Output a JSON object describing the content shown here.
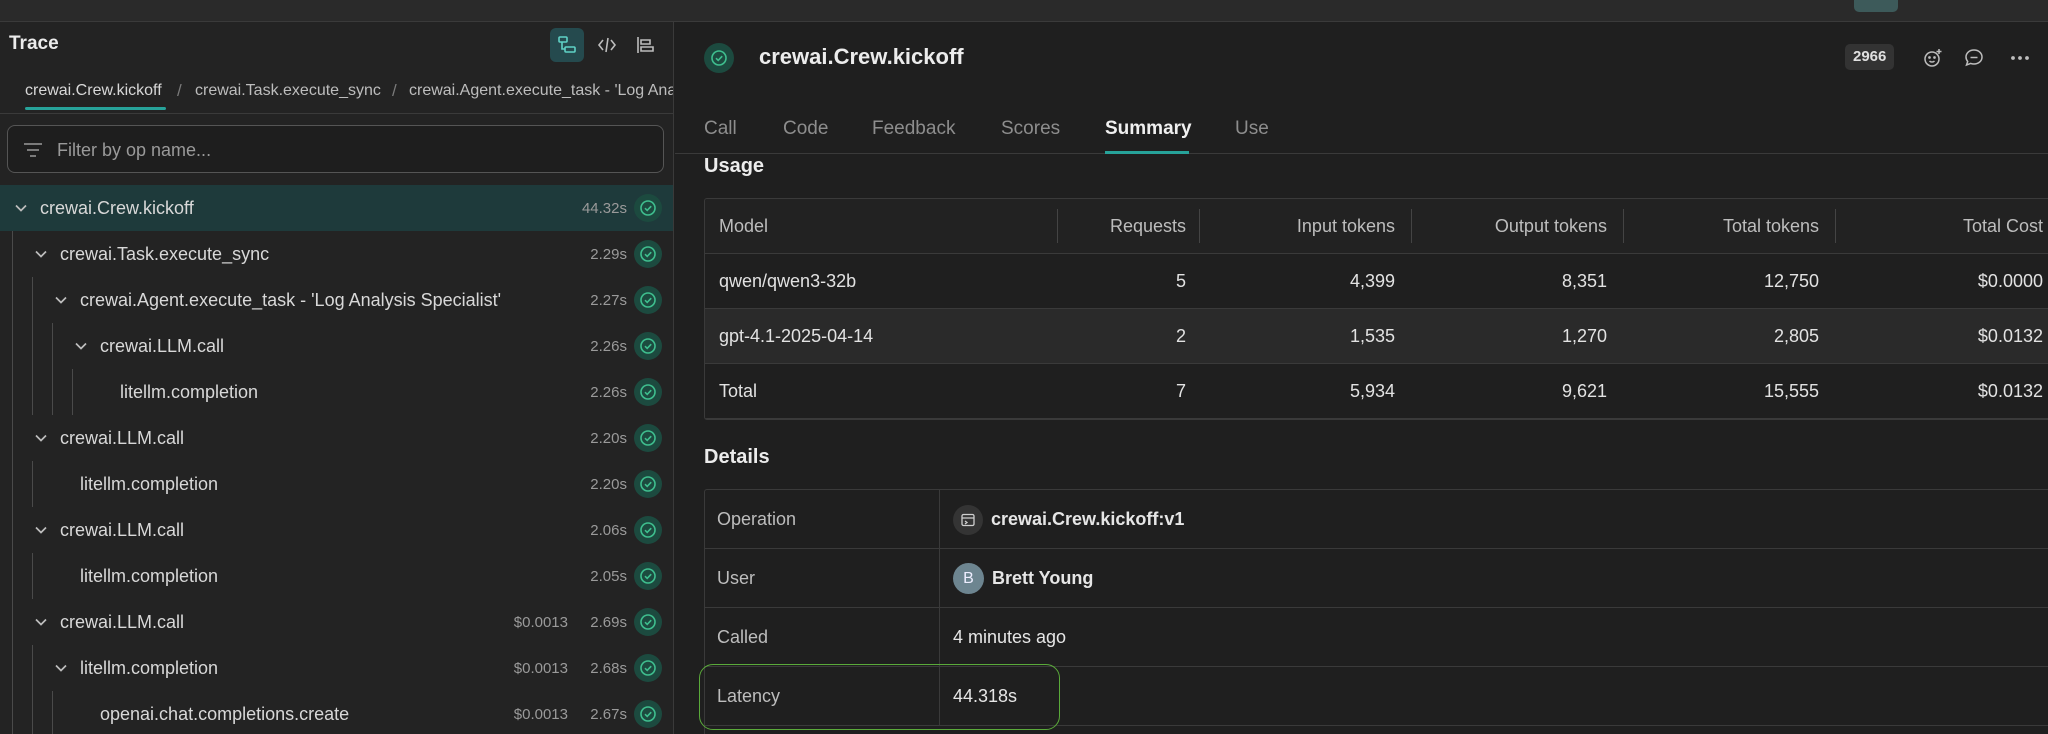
{
  "left": {
    "title": "Trace",
    "view_icons": [
      "tree-view-icon",
      "code-icon",
      "timeline-icon"
    ],
    "breadcrumbs": [
      "crewai.Crew.kickoff",
      "crewai.Task.execute_sync",
      "crewai.Agent.execute_task - 'Log Ana"
    ],
    "filter_placeholder": "Filter by op name...",
    "tree": [
      {
        "label": "crewai.Crew.kickoff",
        "time": "44.32s",
        "cost": ""
      },
      {
        "label": "crewai.Task.execute_sync",
        "time": "2.29s",
        "cost": ""
      },
      {
        "label": "crewai.Agent.execute_task - 'Log Analysis Specialist'",
        "time": "2.27s",
        "cost": ""
      },
      {
        "label": "crewai.LLM.call",
        "time": "2.26s",
        "cost": ""
      },
      {
        "label": "litellm.completion",
        "time": "2.26s",
        "cost": ""
      },
      {
        "label": "crewai.LLM.call",
        "time": "2.20s",
        "cost": ""
      },
      {
        "label": "litellm.completion",
        "time": "2.20s",
        "cost": ""
      },
      {
        "label": "crewai.LLM.call",
        "time": "2.06s",
        "cost": ""
      },
      {
        "label": "litellm.completion",
        "time": "2.05s",
        "cost": ""
      },
      {
        "label": "crewai.LLM.call",
        "time": "2.69s",
        "cost": "$0.0013"
      },
      {
        "label": "litellm.completion",
        "time": "2.68s",
        "cost": "$0.0013"
      },
      {
        "label": "openai.chat.completions.create",
        "time": "2.67s",
        "cost": "$0.0013"
      }
    ]
  },
  "header": {
    "title": "crewai.Crew.kickoff",
    "count_badge": "2966"
  },
  "tabs": [
    "Call",
    "Code",
    "Feedback",
    "Scores",
    "Summary",
    "Use"
  ],
  "active_tab": "Summary",
  "usage": {
    "title": "Usage",
    "columns": [
      "Model",
      "Requests",
      "Input tokens",
      "Output tokens",
      "Total tokens",
      "Total Cost"
    ],
    "rows": [
      [
        "qwen/qwen3-32b",
        "5",
        "4,399",
        "8,351",
        "12,750",
        "$0.0000"
      ],
      [
        "gpt-4.1-2025-04-14",
        "2",
        "1,535",
        "1,270",
        "2,805",
        "$0.0132"
      ],
      [
        "Total",
        "7",
        "5,934",
        "9,621",
        "15,555",
        "$0.0132"
      ]
    ]
  },
  "details": {
    "title": "Details",
    "operation_label": "Operation",
    "operation_value": "crewai.Crew.kickoff:v1",
    "user_label": "User",
    "user_initial": "B",
    "user_value": "Brett Young",
    "called_label": "Called",
    "called_value": "4 minutes ago",
    "latency_label": "Latency",
    "latency_value": "44.318s"
  },
  "colors": {
    "accent": "#27a39a",
    "success": "#3fbf8f",
    "highlight": "#5aaa3a"
  }
}
